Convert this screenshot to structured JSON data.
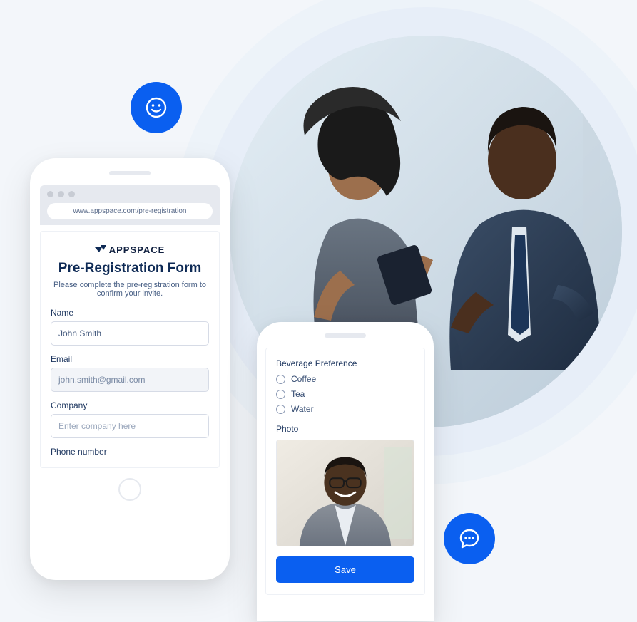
{
  "browser": {
    "url": "www.appspace.com/pre-registration"
  },
  "brand": {
    "name": "APPSPACE"
  },
  "form": {
    "title": "Pre-Registration Form",
    "subtitle": "Please complete the pre-registration form to confirm your invite.",
    "fields": {
      "name": {
        "label": "Name",
        "value": "John Smith"
      },
      "email": {
        "label": "Email",
        "value": "john.smith@gmail.com"
      },
      "company": {
        "label": "Company",
        "placeholder": "Enter company here"
      },
      "phone": {
        "label": "Phone number"
      }
    }
  },
  "preferences": {
    "beverage": {
      "label": "Beverage Preference",
      "options": [
        "Coffee",
        "Tea",
        "Water"
      ]
    },
    "photo": {
      "label": "Photo"
    },
    "save_label": "Save"
  },
  "colors": {
    "accent": "#0a5ff0"
  }
}
